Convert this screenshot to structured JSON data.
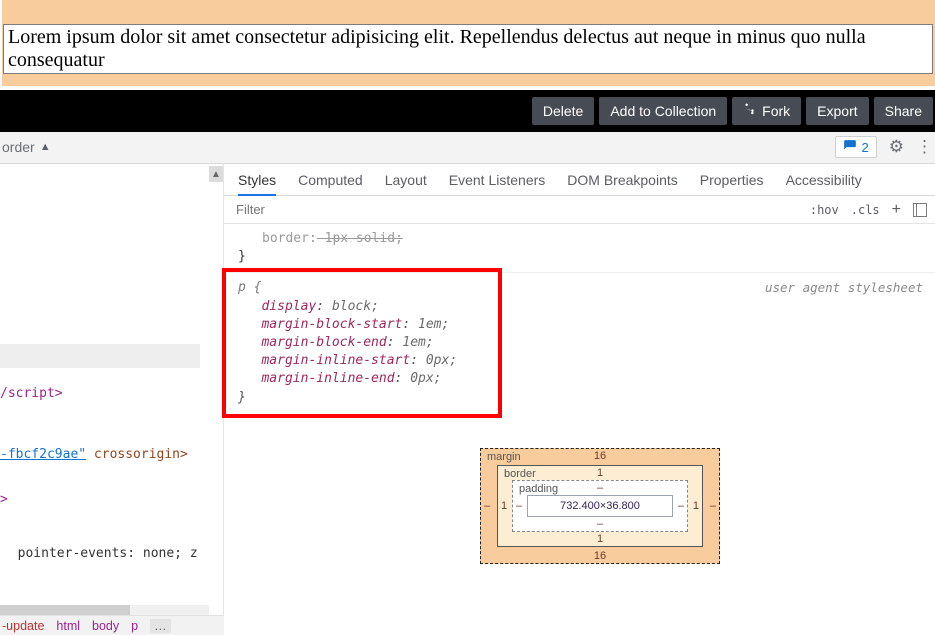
{
  "page": {
    "paragraph": "Lorem ipsum dolor sit amet consectetur adipisicing elit. Repellendus delectus aut neque in minus quo nulla consequatur"
  },
  "toolbar": {
    "delete": "Delete",
    "add_collection": "Add to Collection",
    "fork": "Fork",
    "export": "Export",
    "share": "Share"
  },
  "grey_toolbar": {
    "left_text": "order",
    "comment_count": "2"
  },
  "devtools": {
    "tabs": {
      "styles": "Styles",
      "computed": "Computed",
      "layout": "Layout",
      "event_listeners": "Event Listeners",
      "dom_breakpoints": "DOM Breakpoints",
      "properties": "Properties",
      "accessibility": "Accessibility"
    },
    "filter_placeholder": "Filter",
    "hov": ":hov",
    "cls": ".cls",
    "rule_partial_prefix": "border:",
    "rule_partial_suffix": " 1px solid;",
    "ua_label": "user agent stylesheet",
    "ua_rule": {
      "selector": "p {",
      "l1p": "display",
      "l1v": "block;",
      "l2p": "margin-block-start",
      "l2v": "1em;",
      "l3p": "margin-block-end",
      "l3v": "1em;",
      "l4p": "margin-inline-start",
      "l4v": "0px;",
      "l5p": "margin-inline-end",
      "l5v": "0px;",
      "close": "}"
    },
    "box_model": {
      "margin_label": "margin",
      "border_label": "border",
      "padding_label": "padding",
      "margin_top": "16",
      "margin_bottom": "16",
      "margin_left": "–",
      "margin_right": "–",
      "border_top": "1",
      "border_bottom": "1",
      "border_left": "1",
      "border_right": "1",
      "padding_top": "–",
      "padding_bottom": "–",
      "padding_left": "–",
      "padding_right": "–",
      "content": "732.400×36.800"
    }
  },
  "left_code": {
    "line1": "/script>",
    "line2a": "-fbcf2c9ae\"",
    "line2b": " crossorigin>",
    "line3": ">",
    "line4": "  pointer-events: none; z"
  },
  "crumbs": {
    "c1": "-update",
    "c2": "html",
    "c3": "body",
    "c4": "p",
    "dots": "…"
  }
}
